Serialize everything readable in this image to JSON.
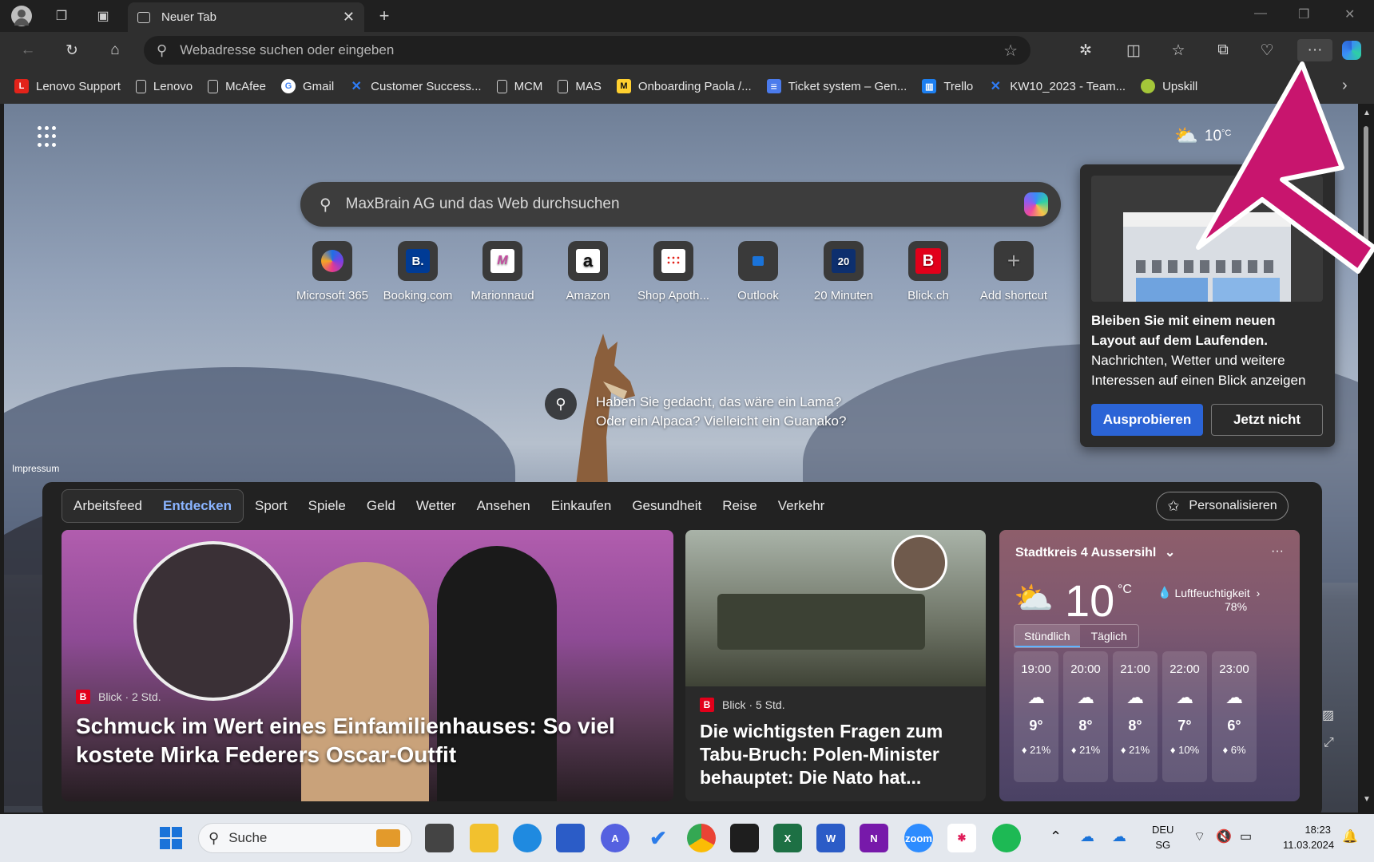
{
  "browser": {
    "tab_title": "Neuer Tab",
    "address_placeholder": "Webadresse suchen oder eingeben",
    "bookmarks": [
      {
        "label": "Lenovo Support",
        "icon": "lenovo-icon",
        "color": "#e2231a"
      },
      {
        "label": "Lenovo",
        "icon": "document-icon"
      },
      {
        "label": "McAfee",
        "icon": "document-icon"
      },
      {
        "label": "Gmail",
        "icon": "google-icon"
      },
      {
        "label": "Customer Success...",
        "icon": "jira-icon"
      },
      {
        "label": "MCM",
        "icon": "document-icon"
      },
      {
        "label": "MAS",
        "icon": "document-icon"
      },
      {
        "label": "Onboarding Paola /...",
        "icon": "miro-icon"
      },
      {
        "label": "Ticket system – Gen...",
        "icon": "google-forms-icon"
      },
      {
        "label": "Trello",
        "icon": "trello-icon"
      },
      {
        "label": "KW10_2023 - Team...",
        "icon": "jira-icon"
      },
      {
        "label": "Upskill",
        "icon": "upskill-icon"
      }
    ]
  },
  "newtab": {
    "weather_top": "10",
    "weather_unit": "°C",
    "search_placeholder": "MaxBrain AG und das Web durchsuchen",
    "shortcuts": [
      {
        "label": "Microsoft 365",
        "glyph": ""
      },
      {
        "label": "Booking.com",
        "glyph": "B."
      },
      {
        "label": "Marionnaud",
        "glyph": "M"
      },
      {
        "label": "Amazon",
        "glyph": "a"
      },
      {
        "label": "Shop Apoth...",
        "glyph": ""
      },
      {
        "label": "Outlook",
        "glyph": ""
      },
      {
        "label": "20 Minuten",
        "glyph": "20"
      },
      {
        "label": "Blick.ch",
        "glyph": "B"
      },
      {
        "label": "Add shortcut",
        "glyph": "+"
      }
    ],
    "trivia_line1": "Haben Sie gedacht, das wäre ein Lama?",
    "trivia_line2": "Oder ein Alpaca? Vielleicht ein Guanako?",
    "impressum": "Impressum"
  },
  "popup": {
    "title": "Bleiben Sie mit einem neuen Layout auf dem Laufenden.",
    "body": "Nachrichten, Wetter und weitere Interessen auf einen Blick anzeigen",
    "primary": "Ausprobieren",
    "secondary": "Jetzt nicht"
  },
  "feed": {
    "segment": [
      "Arbeitsfeed",
      "Entdecken"
    ],
    "tabs": [
      "Sport",
      "Spiele",
      "Geld",
      "Wetter",
      "Ansehen",
      "Einkaufen",
      "Gesundheit",
      "Reise",
      "Verkehr"
    ],
    "personalize": "Personalisieren",
    "card1": {
      "source": "Blick · 2 Std.",
      "headline": "Schmuck im Wert eines Einfamilienhauses: So viel kostete Mirka Federers Oscar-Outfit"
    },
    "card2": {
      "source": "Blick · 5 Std.",
      "headline": "Die wichtigsten Fragen zum Tabu-Bruch: Polen-Minister behauptet: Die Nato hat..."
    },
    "weather": {
      "location": "Stadtkreis 4 Aussersihl",
      "temp": "10",
      "unit": "°C",
      "humidity_label": "Luftfeuchtigkeit",
      "humidity_value": "78%",
      "tab_hourly": "Stündlich",
      "tab_daily": "Täglich",
      "hours": [
        {
          "time": "19:00",
          "temp": "9°",
          "rain": "21%"
        },
        {
          "time": "20:00",
          "temp": "8°",
          "rain": "21%"
        },
        {
          "time": "21:00",
          "temp": "8°",
          "rain": "21%"
        },
        {
          "time": "22:00",
          "temp": "7°",
          "rain": "10%"
        },
        {
          "time": "23:00",
          "temp": "6°",
          "rain": "6%"
        }
      ]
    }
  },
  "taskbar": {
    "search": "Suche",
    "lang1": "DEU",
    "lang2": "SG",
    "time": "18:23",
    "date": "11.03.2024"
  },
  "colors": {
    "accent": "#2b64d6",
    "annotation_arrow": "#c8156e"
  }
}
